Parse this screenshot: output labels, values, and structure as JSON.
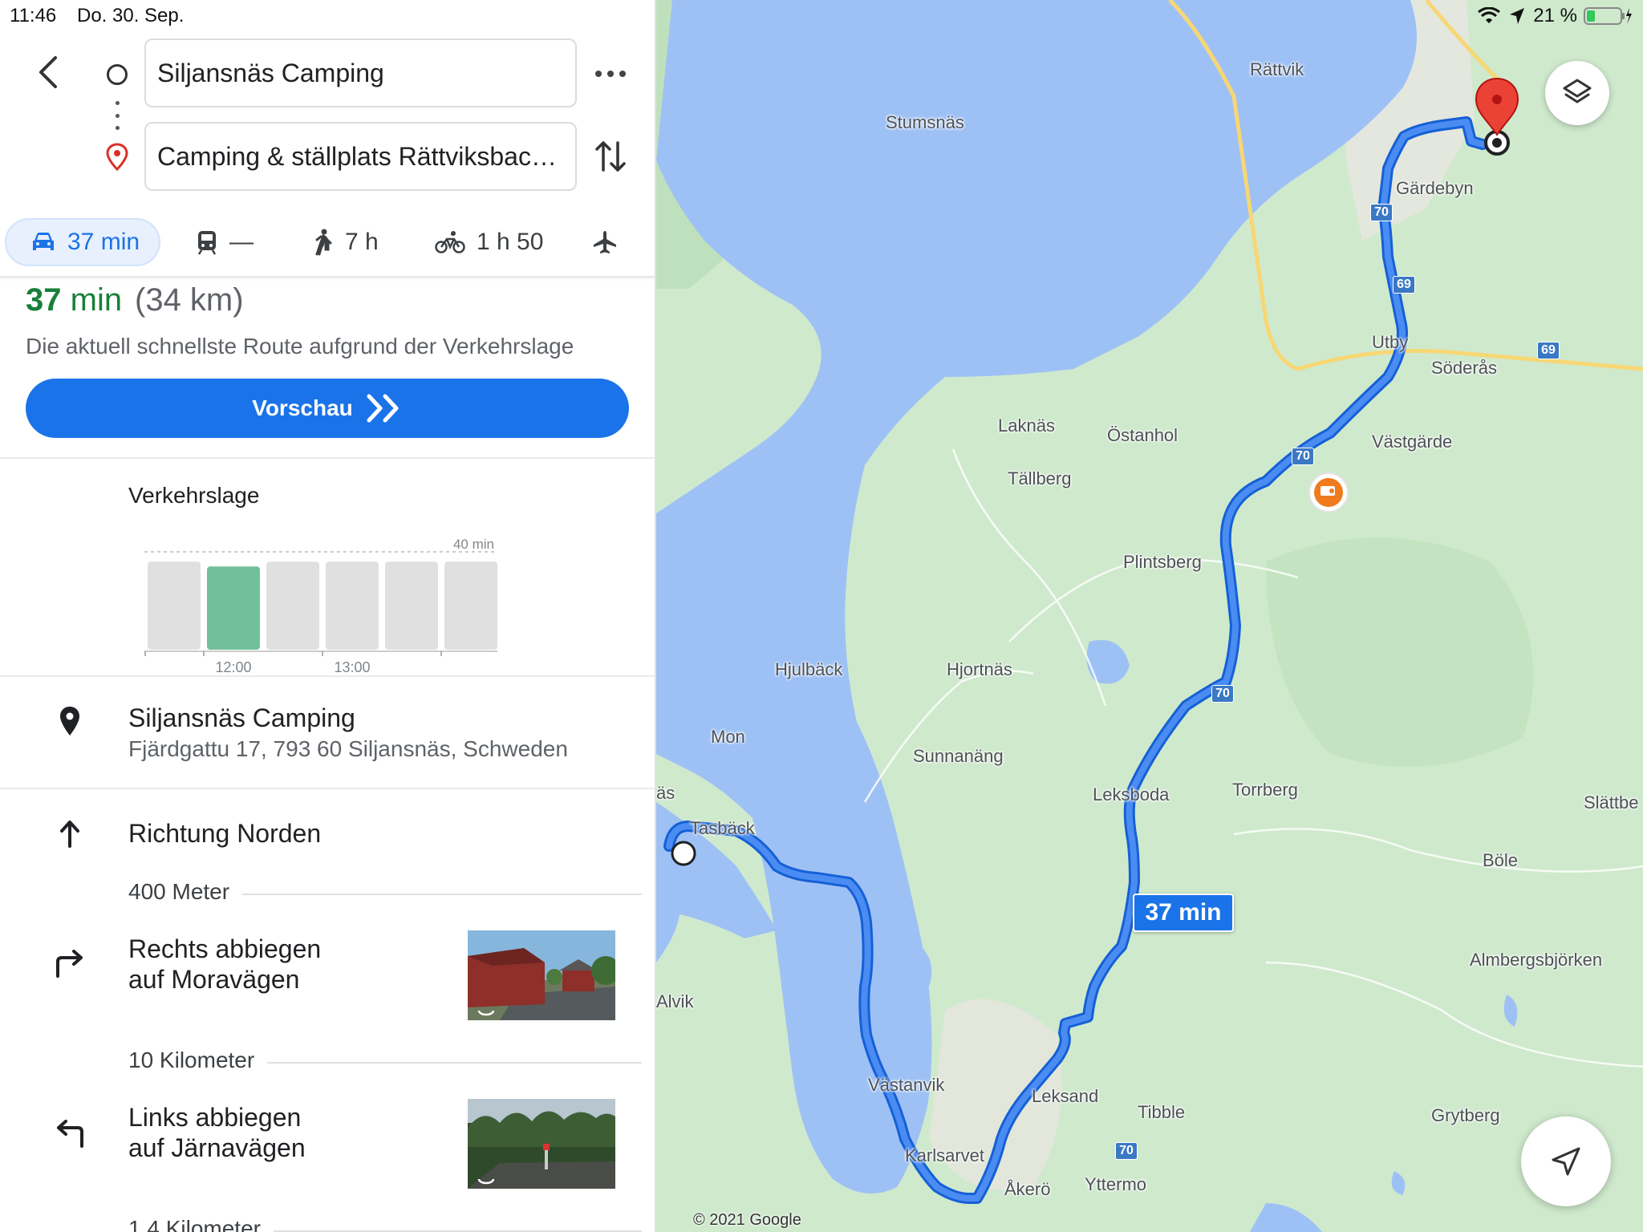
{
  "status": {
    "time": "11:46",
    "date": "Do. 30. Sep.",
    "battery": "21 %"
  },
  "search": {
    "origin": "Siljansnäs Camping",
    "destination": "Camping & ställplats Rättviksbacken"
  },
  "modes": [
    {
      "name": "drive",
      "icon": "car-icon",
      "label": "37 min",
      "selected": true
    },
    {
      "name": "transit",
      "icon": "train-icon",
      "label": "—"
    },
    {
      "name": "walk",
      "icon": "walk-icon",
      "label": "7 h"
    },
    {
      "name": "bike",
      "icon": "bike-icon",
      "label": "1 h 50"
    },
    {
      "name": "fly",
      "icon": "plane-icon",
      "label": ""
    }
  ],
  "summary": {
    "duration_value": "37",
    "duration_unit": "min",
    "distance": "(34 km)",
    "description": "Die aktuell schnellste Route aufgrund der Verkehrslage",
    "preview_label": "Vorschau"
  },
  "traffic": {
    "title": "Verkehrslage",
    "max_label": "40 min",
    "time_labels": [
      "12:00",
      "13:00"
    ],
    "accent_color": "#72bf9c",
    "bar_color": "#e0e0e0"
  },
  "chart_data": {
    "type": "bar",
    "title": "Verkehrslage",
    "tick_labels": [
      "12:00",
      "13:00"
    ],
    "ylim": [
      0,
      40
    ],
    "values": [
      36,
      34,
      36,
      36,
      36,
      36
    ],
    "highlight_index": 1
  },
  "itinerary": {
    "start": {
      "name": "Siljansnäs Camping",
      "address": "Fjärdgattu 17, 793 60 Siljansnäs, Schweden"
    },
    "steps": [
      {
        "icon": "arrow-up-icon",
        "line1": "Richtung Norden",
        "line2": "",
        "distance": "400 Meter"
      },
      {
        "icon": "turn-right-icon",
        "line1": "Rechts abbiegen",
        "line2": "auf Moravägen",
        "distance": "10 Kilometer"
      },
      {
        "icon": "turn-left-icon",
        "line1": "Links abbiegen",
        "line2": "auf Järnavägen",
        "distance": "1,4 Kilometer"
      }
    ]
  },
  "map": {
    "route_label": "37 min",
    "copyright": "© 2021 Google",
    "route_color": "#1a73e8",
    "places": [
      "Rättvik",
      "Stumsnäs",
      "Gärdebyn",
      "Utby",
      "Söderås",
      "Laknäs",
      "Östanhol",
      "Västgärde",
      "Tällberg",
      "Plintsberg",
      "Hjulbäck",
      "Hjortnäs",
      "Mon",
      "Sunnanäng",
      "Leksboda",
      "Torrberg",
      "Slättbe",
      "Tasbäck",
      "Böle",
      "Almbergsbjörken",
      "äs",
      "Alvik",
      "Västanvik",
      "Leksand",
      "Tibble",
      "Grytberg",
      "Karlsarvet",
      "Åkerö",
      "Yttermo"
    ],
    "road_numbers": [
      "70",
      "69",
      "69",
      "70",
      "70",
      "70"
    ]
  }
}
